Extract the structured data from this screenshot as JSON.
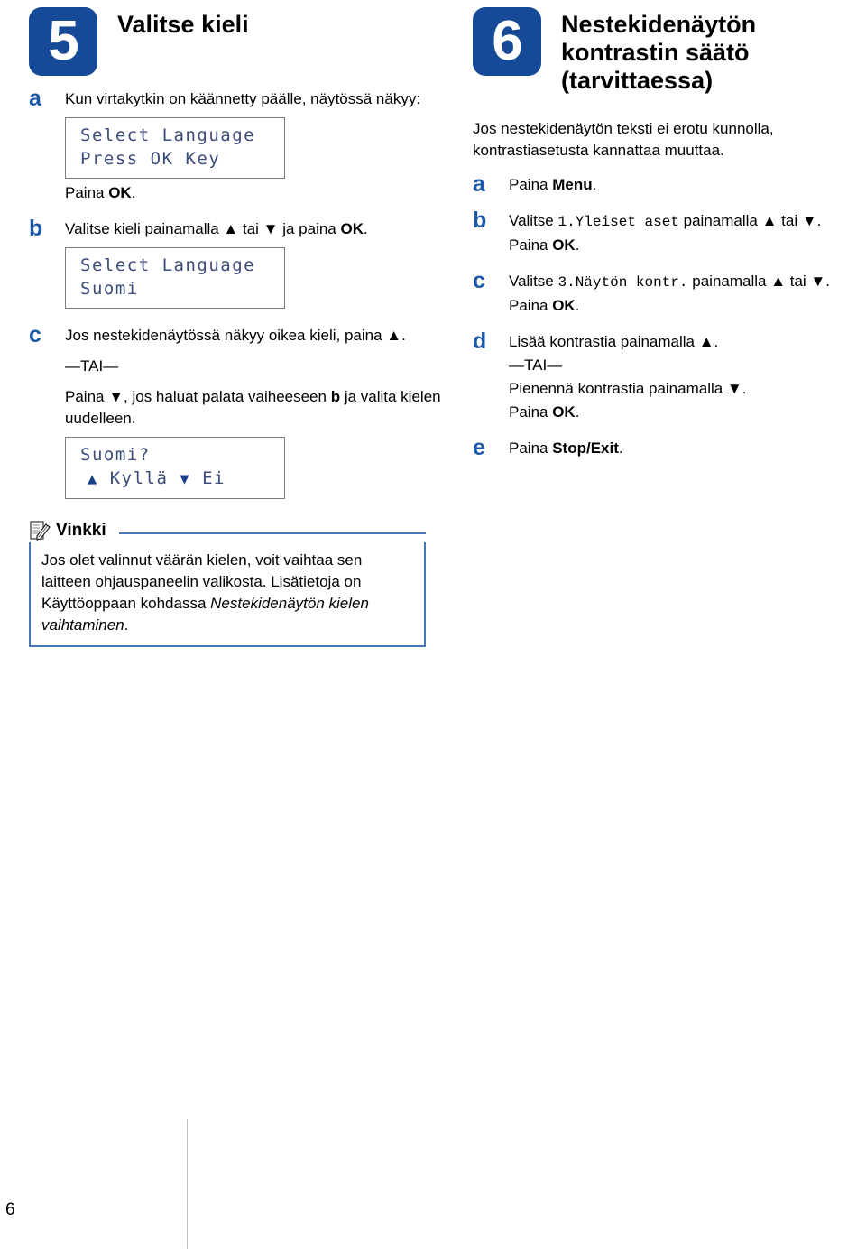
{
  "page": {
    "number": "6"
  },
  "left_section": {
    "badge": "5",
    "title": "Valitse kieli",
    "steps": [
      {
        "letter": "a",
        "lines": [
          "Kun virtakytkin on käännetty päälle, näytössä näkyy:"
        ],
        "lcd": {
          "line1": "Select Language",
          "line2": "Press OK Key"
        },
        "after": "Paina OK."
      },
      {
        "letter": "b",
        "lines": [
          "Valitse kieli painamalla ▲ tai ▼ ja paina OK."
        ],
        "lcd": {
          "line1": "Select Language",
          "line2": "Suomi"
        }
      },
      {
        "letter": "c",
        "line1": "Jos nestekidenäytössä näkyy oikea kieli, paina ▲.",
        "or": "—TAI—",
        "line2": "Paina ▼, jos haluat palata vaiheeseen b ja valita kielen uudelleen.",
        "lcd": {
          "line1": "Suomi?",
          "line2_tri_up": "▲",
          "line2_yes": "Kyllä",
          "line2_tri_down": "▼",
          "line2_no": "Ei"
        }
      }
    ],
    "note": {
      "icon": "note-pencil-icon",
      "title": "Vinkki",
      "body_plain_1": "Jos olet valinnut väärän kielen, voit vaihtaa sen laitteen ohjauspaneelin valikosta. Lisätietoja on Käyttöoppaan kohdassa ",
      "body_italic": "Nestekidenäytön kielen vaihtaminen",
      "body_plain_2": "."
    }
  },
  "right_section": {
    "badge": "6",
    "title": "Nestekidenäytön kontrastin säätö (tarvittaessa)",
    "intro": "Jos nestekidenäytön teksti ei erotu kunnolla, kontrastiasetusta kannattaa muuttaa.",
    "steps": [
      {
        "letter": "a",
        "prefix": "Paina ",
        "bold": "Menu",
        "suffix": "."
      },
      {
        "letter": "b",
        "prefix": "Valitse ",
        "mono": "1.Yleiset aset",
        "suffix": " painamalla ▲ tai ▼.",
        "second": "Paina OK."
      },
      {
        "letter": "c",
        "prefix": "Valitse ",
        "mono": "3.Näytön kontr.",
        "suffix": " painamalla ▲ tai ▼.",
        "second": "Paina OK."
      },
      {
        "letter": "d",
        "line1": "Lisää kontrastia painamalla ▲.",
        "or": "—TAI—",
        "line2": "Pienennä kontrastia painamalla ▼.",
        "line3": "Paina OK."
      },
      {
        "letter": "e",
        "prefix": "Paina ",
        "bold": "Stop/Exit",
        "suffix": "."
      }
    ]
  },
  "colors": {
    "badge_blue": "#174A96",
    "letter_blue": "#1B58A5",
    "note_border_blue": "#4775B5",
    "lcd_text": "#3b4c7a"
  }
}
